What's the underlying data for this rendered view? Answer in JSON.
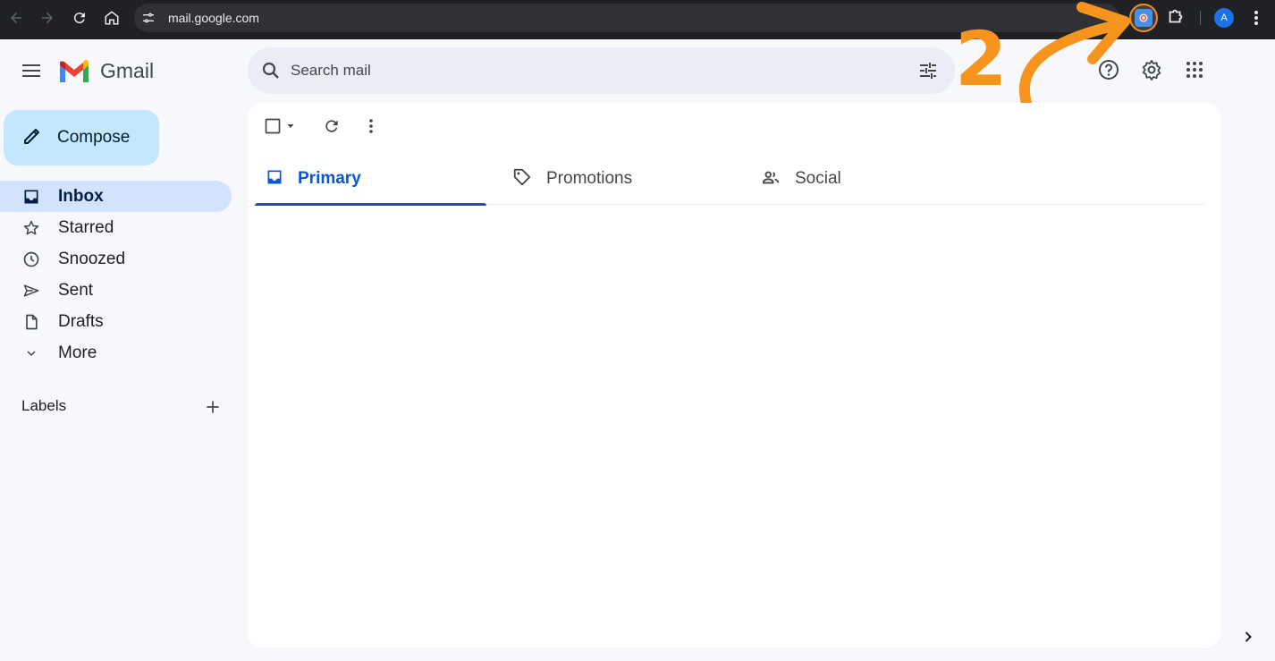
{
  "browser": {
    "url": "mail.google.com",
    "profile_initial": "A",
    "nav_icons": [
      "back-arrow-icon",
      "forward-arrow-icon",
      "reload-icon",
      "home-icon"
    ]
  },
  "app": {
    "name": "Gmail",
    "search_placeholder": "Search mail"
  },
  "sidebar": {
    "compose_label": "Compose",
    "items": [
      {
        "label": "Inbox",
        "icon": "inbox-icon",
        "active": true
      },
      {
        "label": "Starred",
        "icon": "star-icon"
      },
      {
        "label": "Snoozed",
        "icon": "clock-icon"
      },
      {
        "label": "Sent",
        "icon": "send-icon"
      },
      {
        "label": "Drafts",
        "icon": "draft-icon"
      },
      {
        "label": "More",
        "icon": "chevron-down-icon"
      }
    ],
    "labels_title": "Labels"
  },
  "tabs": [
    {
      "label": "Primary",
      "icon": "inbox-icon",
      "active": true
    },
    {
      "label": "Promotions",
      "icon": "tag-icon"
    },
    {
      "label": "Social",
      "icon": "people-icon"
    }
  ],
  "annotation": {
    "step_number": "2",
    "color": "#f7941d"
  },
  "colors": {
    "accent": "#0b57d0",
    "compose_bg": "#c2e7ff",
    "active_nav_bg": "#d3e3fd",
    "page_bg": "#f6f8fc"
  }
}
